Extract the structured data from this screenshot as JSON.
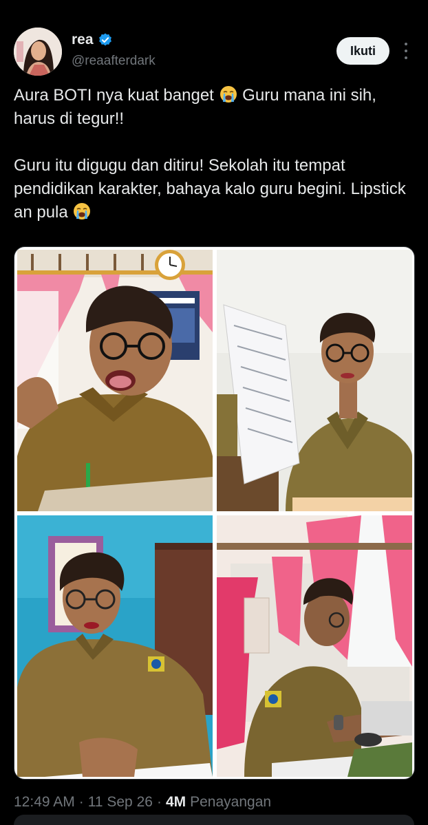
{
  "author": {
    "display_name": "rea",
    "handle": "@reaafterdark",
    "verified_icon": "verified-badge-icon",
    "avatar": "profile-photo"
  },
  "follow_button": {
    "label": "Ikuti"
  },
  "more_icon": "more-vertical-icon",
  "tweet": {
    "line1_a": "Aura BOTI nya kuat banget ",
    "line1_b": " Guru mana ini sih, harus di tegur!!",
    "line2_a": "Guru itu digugu dan ditiru! Sekolah itu tempat pendidikan karakter, bahaya kalo guru begini. Lipstick an pula ",
    "emoji": "loudly-crying-face-emoji"
  },
  "media": {
    "photos": [
      "photo-teacher-talking-in-classroom",
      "photo-teacher-holding-papers",
      "photo-teacher-at-desk-blue-wall",
      "photo-teacher-typing-on-laptop"
    ]
  },
  "meta": {
    "time": "12:49 AM",
    "date": "11 Sep 26",
    "views_count": "4M",
    "views_label": "Penayangan",
    "separator": "·"
  },
  "colors": {
    "background": "#000000",
    "text": "#e7e9ea",
    "secondary": "#71767b",
    "verified": "#1d9bf0",
    "follow_bg": "#eff3f4"
  }
}
